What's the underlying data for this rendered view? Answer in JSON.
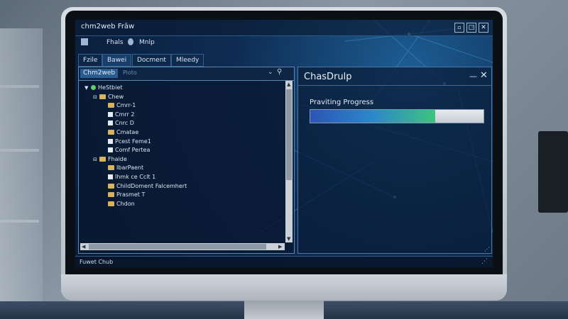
{
  "window": {
    "title": "chm2web Frāw",
    "icon": "app-icon",
    "min_icon": "minimize-icon",
    "max_icon": "maximize-icon",
    "close_icon": "close-icon"
  },
  "toolbar": {
    "item1_icon": "file-icon",
    "item1_label": "Fhals",
    "item2_icon": "help-icon",
    "item2_label": "Mnlp"
  },
  "tabs": [
    {
      "label": "Fzile",
      "active": false
    },
    {
      "label": "Bawei",
      "active": true
    },
    {
      "label": "Docment",
      "active": false
    },
    {
      "label": "Mleedy",
      "active": false
    }
  ],
  "explorer": {
    "breadcrumb": "Chm2web",
    "path_placeholder": "Pioto",
    "tree": [
      {
        "label": "HeStbiet",
        "depth": 0,
        "icon": "green-icon",
        "expander": "▼"
      },
      {
        "label": "Chew",
        "depth": 1,
        "icon": "folder-icon",
        "expander": "⊟"
      },
      {
        "label": "Cmrr-1",
        "depth": 2,
        "icon": "folder-icon",
        "expander": ""
      },
      {
        "label": "Cmrr 2",
        "depth": 2,
        "icon": "doc-icon",
        "expander": ""
      },
      {
        "label": "Cnrc D",
        "depth": 2,
        "icon": "doc-icon",
        "expander": ""
      },
      {
        "label": "Cmatae",
        "depth": 2,
        "icon": "folder-icon",
        "expander": ""
      },
      {
        "label": "Pcest Feme1",
        "depth": 2,
        "icon": "doc-icon",
        "expander": ""
      },
      {
        "label": "Comf Pertea",
        "depth": 2,
        "icon": "doc-icon",
        "expander": ""
      },
      {
        "label": "Fhaide",
        "depth": 1,
        "icon": "folder-icon",
        "expander": "⊟"
      },
      {
        "label": "IbarPaent",
        "depth": 2,
        "icon": "folder-icon",
        "expander": ""
      },
      {
        "label": "Ihmk ce Cclt 1",
        "depth": 2,
        "icon": "doc-icon",
        "expander": ""
      },
      {
        "label": "ChildDoment Falcemhert",
        "depth": 2,
        "icon": "folder-icon",
        "expander": ""
      },
      {
        "label": "Prasmet T",
        "depth": 2,
        "icon": "folder-icon",
        "expander": ""
      },
      {
        "label": "Chdon",
        "depth": 2,
        "icon": "folder-icon",
        "expander": ""
      }
    ]
  },
  "dialog": {
    "title": "ChasDrulp",
    "progress_label": "Praviting Progress",
    "progress": 0.72,
    "min_glyph": "—",
    "close_glyph": "✕"
  },
  "status": {
    "text": "Fuwet Chub"
  },
  "colors": {
    "accent": "#2a5c92",
    "progress_start": "#2b55b8",
    "progress_end": "#3cc47f",
    "screen_bg": "#0e2c52"
  }
}
